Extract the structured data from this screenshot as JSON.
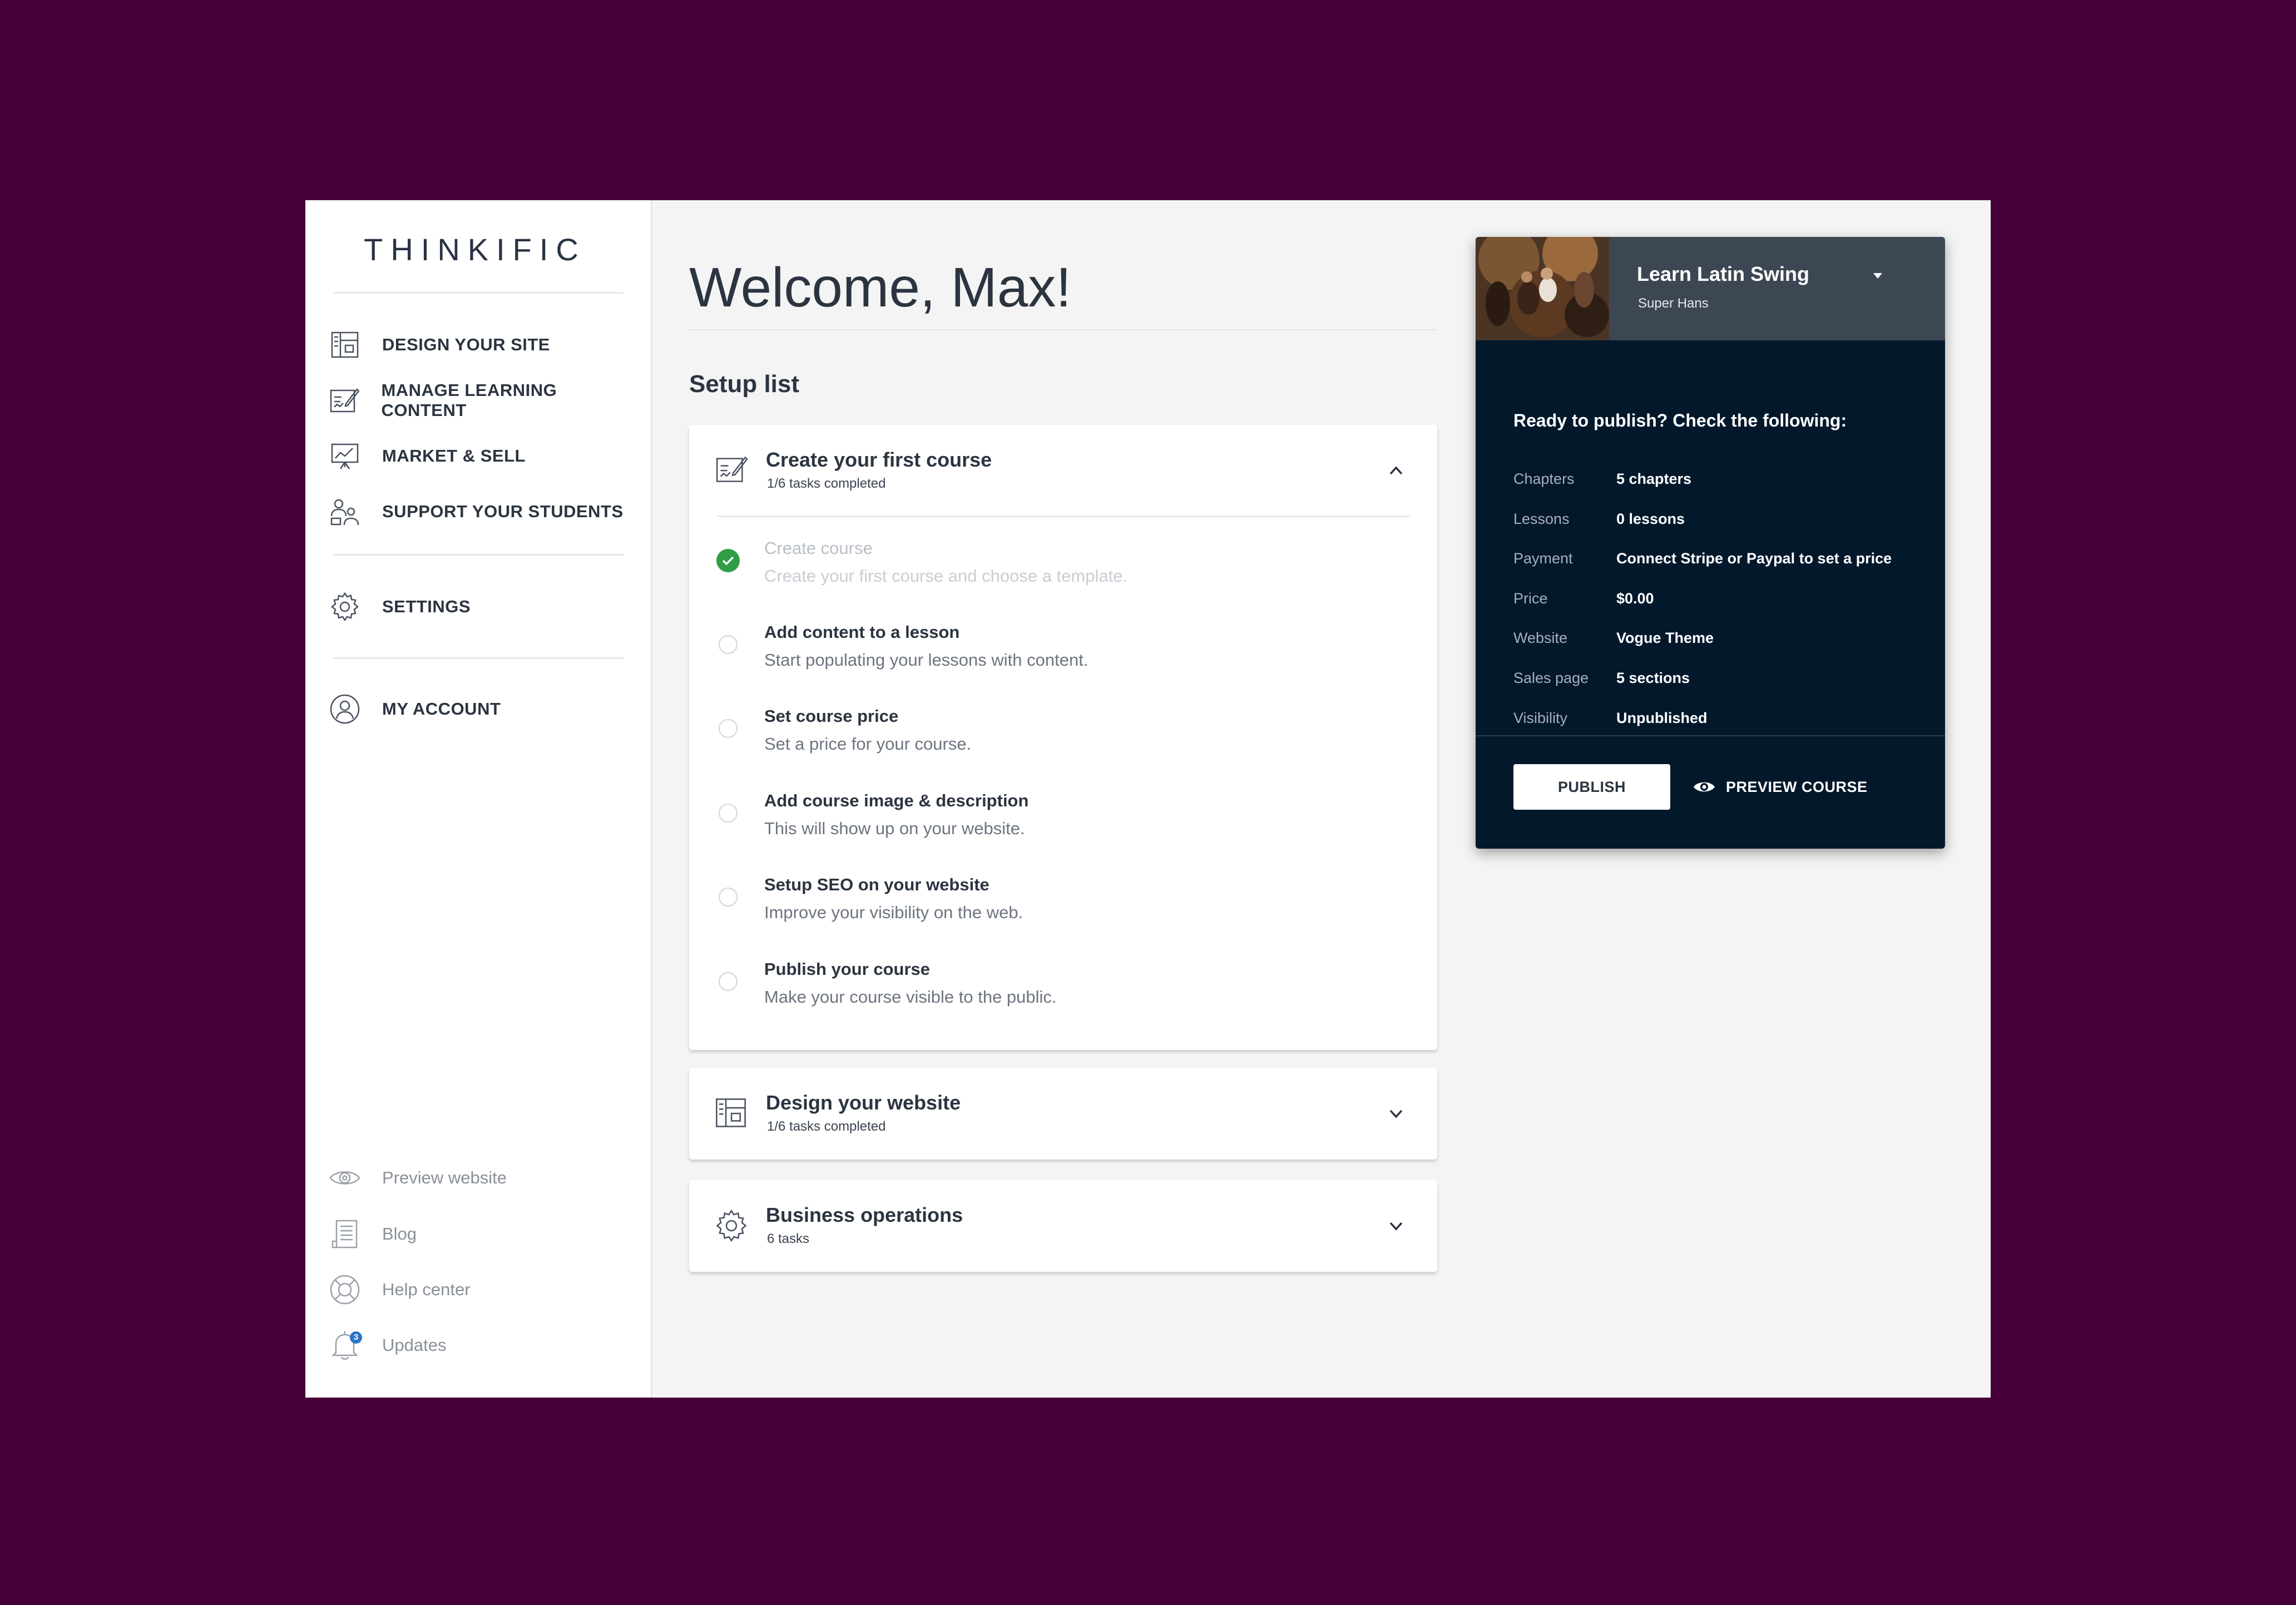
{
  "brand": {
    "logo": "THINKIFIC",
    "background": "#450039",
    "panel_color": "#03182b",
    "success_color": "#2f9e44"
  },
  "sidebar": {
    "main_items": [
      {
        "label": "DESIGN YOUR SITE",
        "icon": "layout-icon"
      },
      {
        "label": "MANAGE LEARNING CONTENT",
        "icon": "edit-board-icon"
      },
      {
        "label": "MARKET & SELL",
        "icon": "presentation-chart-icon"
      },
      {
        "label": "SUPPORT YOUR STUDENTS",
        "icon": "people-icon"
      }
    ],
    "settings": {
      "label": "SETTINGS",
      "icon": "gear-icon"
    },
    "account": {
      "label": "MY ACCOUNT",
      "icon": "user-circle-icon"
    },
    "footer_items": [
      {
        "label": "Preview website",
        "icon": "eye-icon"
      },
      {
        "label": "Blog",
        "icon": "document-icon"
      },
      {
        "label": "Help center",
        "icon": "lifebuoy-icon"
      },
      {
        "label": "Updates",
        "icon": "bell-icon",
        "badge": "3"
      }
    ]
  },
  "main": {
    "welcome": "Welcome, Max!",
    "setup_title": "Setup list",
    "sections": [
      {
        "title": "Create your first course",
        "subtitle": "1/6 tasks completed",
        "icon": "edit-board-icon",
        "expanded": true,
        "tasks": [
          {
            "title": "Create course",
            "description": "Create your first course and choose a template.",
            "done": true
          },
          {
            "title": "Add content to a lesson",
            "description": "Start populating your lessons with content.",
            "done": false
          },
          {
            "title": "Set course price",
            "description": "Set a price for your course.",
            "done": false
          },
          {
            "title": "Add course image & description",
            "description": "This will show up on your website.",
            "done": false
          },
          {
            "title": "Setup SEO on your website",
            "description": "Improve your visibility on the web.",
            "done": false
          },
          {
            "title": "Publish your course",
            "description": "Make your course visible to the public.",
            "done": false
          }
        ]
      },
      {
        "title": "Design your website",
        "subtitle": "1/6 tasks completed",
        "icon": "layout-icon",
        "expanded": false
      },
      {
        "title": "Business operations",
        "subtitle": "6 tasks",
        "icon": "gear-icon",
        "expanded": false
      }
    ]
  },
  "panel": {
    "course_name": "Learn Latin Swing",
    "author": "Super Hans",
    "ready_text": "Ready to publish? Check the following:",
    "details": [
      {
        "key": "Chapters",
        "value": "5 chapters"
      },
      {
        "key": "Lessons",
        "value": "0 lessons"
      },
      {
        "key": "Payment",
        "value": "Connect Stripe or Paypal to set a price"
      },
      {
        "key": "Price",
        "value": "$0.00"
      },
      {
        "key": "Website",
        "value": "Vogue Theme"
      },
      {
        "key": "Sales page",
        "value": "5 sections"
      },
      {
        "key": "Visibility",
        "value": "Unpublished"
      }
    ],
    "publish_label": "PUBLISH",
    "preview_label": "PREVIEW COURSE"
  }
}
